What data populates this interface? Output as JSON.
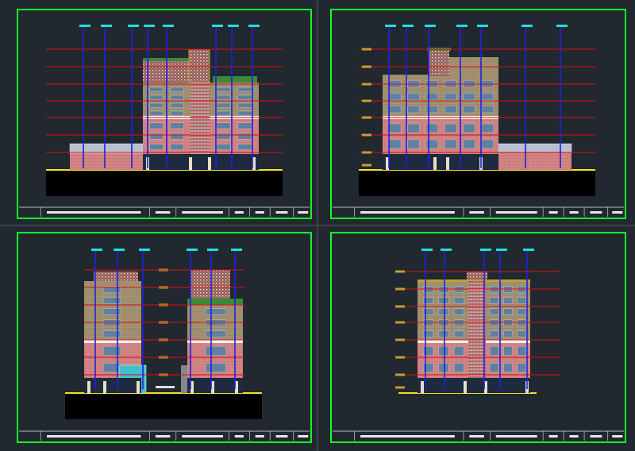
{
  "canvas": {
    "background": "#212830",
    "sheet_border": "#14ff28",
    "title_block_line": "#e8e8e8"
  },
  "palette": {
    "grid_red": "#e01010",
    "pipe_blue": "#2020e0",
    "pipe_cap_cyan": "#20e0e0",
    "ground_yellow": "#f0e020",
    "ground_black": "#000000",
    "brick_pink": "#c87878",
    "upper_tan": "#9a8868",
    "roof_mosaic": "#a05858",
    "roof_green": "#3a8a3a",
    "window_blue": "#6080a0",
    "level_marker": "#c0a030"
  },
  "sheets": [
    {
      "name": "elevation-front",
      "title_block_text": ""
    },
    {
      "name": "elevation-rear",
      "title_block_text": ""
    },
    {
      "name": "elevation-side-left",
      "title_block_text": ""
    },
    {
      "name": "elevation-side-right",
      "title_block_text": ""
    }
  ]
}
